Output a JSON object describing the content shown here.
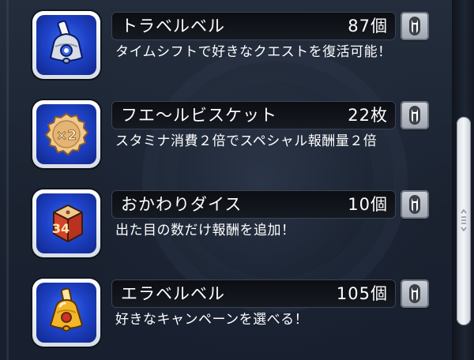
{
  "items": [
    {
      "name": "トラベルベル",
      "count": "87個",
      "description": "タイムシフトで好きなクエストを復活可能！",
      "icon": "blue-bell-icon"
    },
    {
      "name": "フエ〜ルビスケット",
      "count": "22枚",
      "description": "スタミナ消費２倍でスペシャル報酬量２倍",
      "icon": "biscuit-icon",
      "icon_text": "×2"
    },
    {
      "name": "おかわりダイス",
      "count": "10個",
      "description": "出た目の数だけ報酬を追加！",
      "icon": "dice-icon",
      "icon_text": "34"
    },
    {
      "name": "エラベルベル",
      "count": "105個",
      "description": "好きなキャンペーンを選べる！",
      "icon": "gold-bell-icon"
    }
  ],
  "colors": {
    "background": "#1b2432",
    "icon_blue": "#1e43c9",
    "name_bar": "#0b0d12",
    "text": "#ffffff",
    "info_button": "#b8bcc4",
    "scroll_thumb": "#eef0f4"
  }
}
